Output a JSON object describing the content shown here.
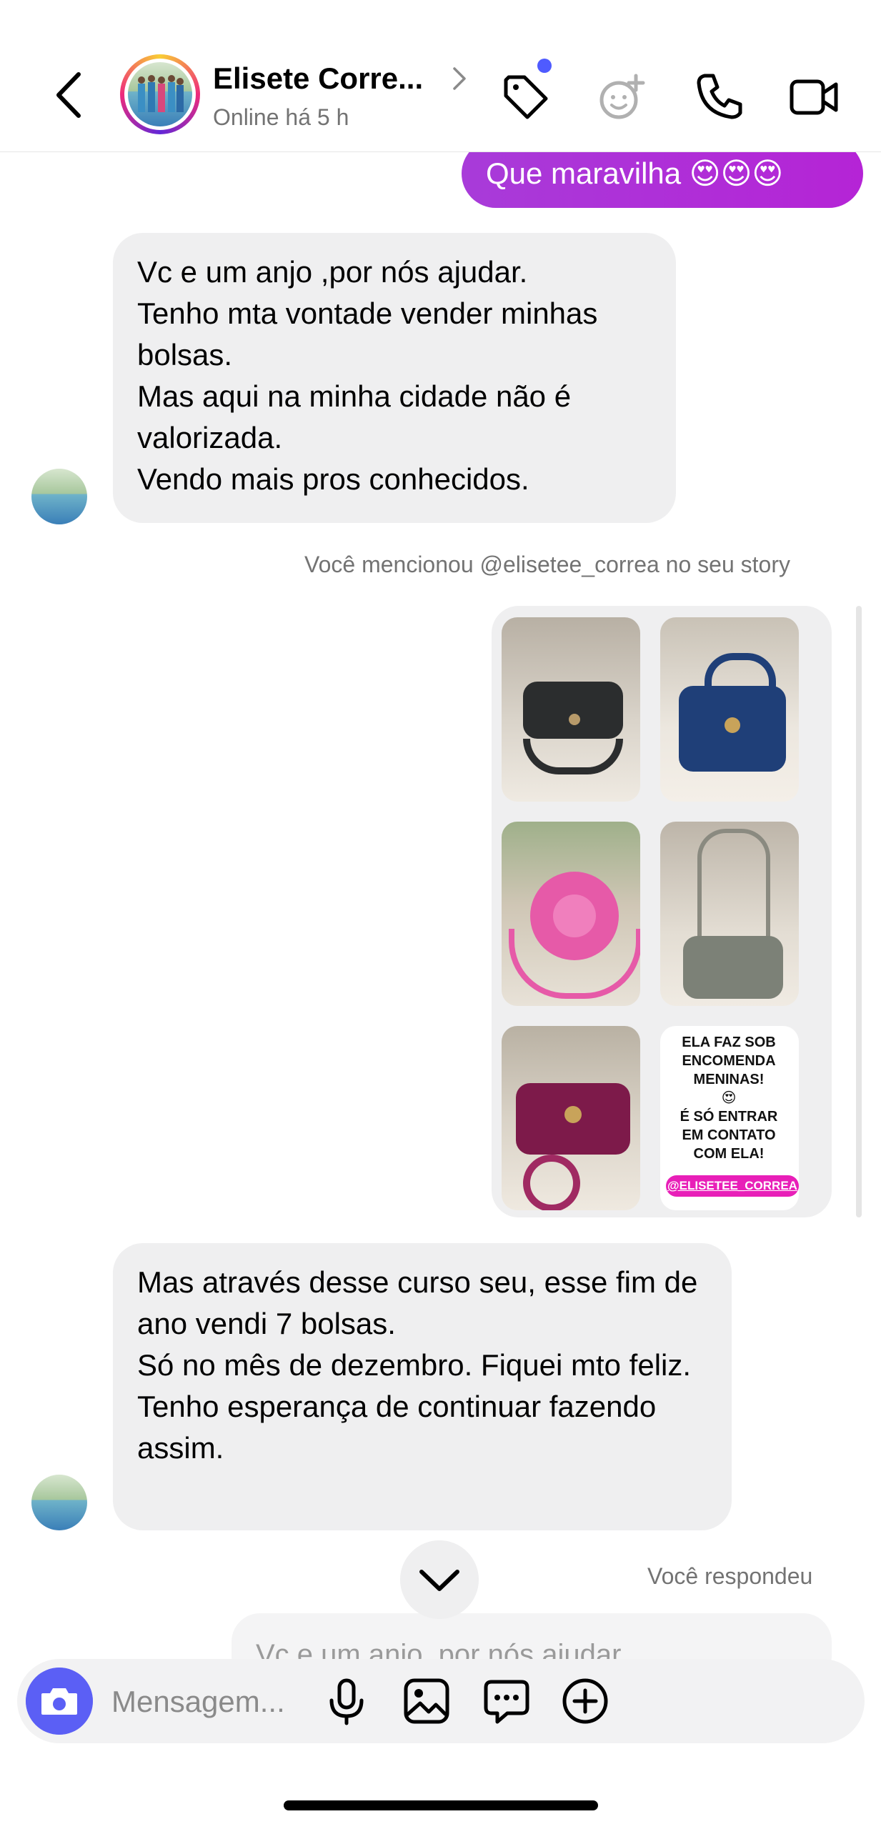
{
  "header": {
    "contact_name": "Elisete Corre...",
    "status": "Online há 5 h",
    "icons": [
      "back-arrow-icon",
      "tag-icon",
      "effects-icon",
      "phone-icon",
      "video-icon"
    ]
  },
  "messages": {
    "out_first": "Que maravilha 😍😍😍",
    "in_first": [
      "Vc e um anjo ,por nós ajudar.",
      "Tenho mta vontade vender  minhas bolsas.",
      "Mas aqui na minha cidade não é valorizada.",
      "Vendo mais pros conhecidos."
    ],
    "story_notice": "Você mencionou @elisetee_correa no seu story",
    "story": {
      "text_lines": [
        "ELA FAZ SOB",
        "ENCOMENDA",
        "MENINAS!",
        "😍",
        "É SÓ ENTRAR",
        "EM CONTATO",
        "COM ELA!"
      ],
      "tag": "@ELISETEE_CORREA"
    },
    "in_second": [
      "Mas através desse curso seu, esse fim de ano vendi 7 bolsas.",
      "Só no mês de dezembro. Fiquei mto feliz.",
      "Tenho esperança de continuar fazendo assim."
    ],
    "reply_notice": "Você respondeu",
    "reply_preview": "Vc e um anjo ,por nós ajudar."
  },
  "composer": {
    "placeholder": "Mensagem...",
    "icons": [
      "camera-icon",
      "microphone-icon",
      "gallery-icon",
      "sticker-icon",
      "add-icon"
    ]
  },
  "colors": {
    "accent": "#5b5ff5",
    "outgoing_bubble": "#b02fd8",
    "incoming_bubble": "#efeff0",
    "story_tag": "#e81fb8"
  }
}
